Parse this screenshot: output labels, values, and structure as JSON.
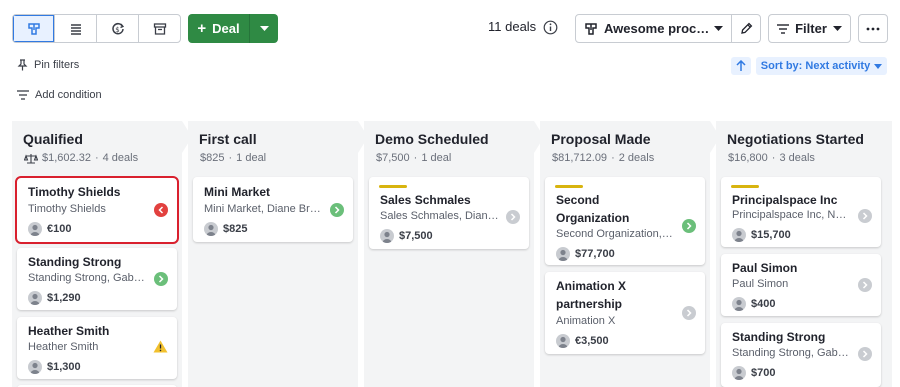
{
  "toolbar": {
    "views": [
      "pipeline-view",
      "list-view",
      "forecast-view",
      "archive-view"
    ],
    "add_label": "Deal",
    "deal_count": "11 deals",
    "pipeline_name": "Awesome proc…",
    "filter_label": "Filter"
  },
  "filters": {
    "pin_label": "Pin filters",
    "add_condition_label": "Add condition",
    "sort_label": "Sort by: Next activity"
  },
  "colors": {
    "accent": "#317ae2",
    "green": "#2f8a44",
    "stage_bg": "#f3f4f5",
    "rotten": "#d9202e",
    "deal_bar": "#d8b40f"
  },
  "stages": [
    {
      "name": "Qualified",
      "total": "$1,602.32",
      "count": "4 deals",
      "deals": [
        {
          "title": "Timothy Shields",
          "subtitle": "Timothy Shields",
          "value": "€100",
          "status": "red-left"
        },
        {
          "title": "Standing Strong",
          "subtitle": "Standing Strong, Gab…",
          "value": "$1,290",
          "status": "green"
        },
        {
          "title": "Heather Smith",
          "subtitle": "Heather Smith",
          "value": "$1,300",
          "status": "warning"
        }
      ]
    },
    {
      "name": "First call",
      "total": "$825",
      "count": "1 deal",
      "deals": [
        {
          "title": "Mini Market",
          "subtitle": "Mini Market, Diane Br…",
          "value": "$825",
          "status": "green"
        }
      ]
    },
    {
      "name": "Demo Scheduled",
      "total": "$7,500",
      "count": "1 deal",
      "deals": [
        {
          "title": "Sales Schmales",
          "subtitle": "Sales Schmales, Dian…",
          "value": "$7,500",
          "status": "grey"
        }
      ]
    },
    {
      "name": "Proposal Made",
      "total": "$81,712.09",
      "count": "2 deals",
      "deals": [
        {
          "title_line1": "Second",
          "title_line2": "Organization",
          "subtitle": "Second Organization,…",
          "value": "$77,700",
          "status": "green"
        },
        {
          "title_line1": "Animation X",
          "title_line2": "partnership",
          "subtitle": "Animation X",
          "value": "€3,500",
          "status": "grey"
        }
      ]
    },
    {
      "name": "Negotiations Started",
      "total": "$16,800",
      "count": "3 deals",
      "deals": [
        {
          "title": "Principalspace Inc",
          "subtitle": "Principalspace Inc, N…",
          "value": "$15,700",
          "status": "grey"
        },
        {
          "title": "Paul Simon",
          "subtitle": "Paul Simon",
          "value": "$400",
          "status": "grey"
        },
        {
          "title": "Standing Strong",
          "subtitle": "Standing Strong, Gab…",
          "value": "$700",
          "status": "grey"
        }
      ]
    }
  ]
}
